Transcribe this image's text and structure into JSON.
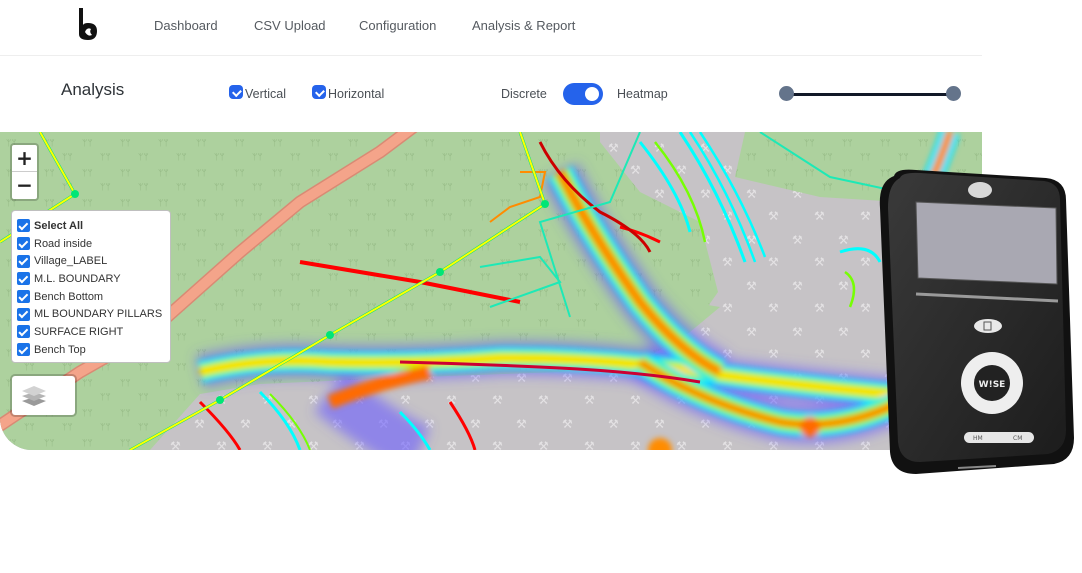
{
  "app": {
    "logo_icon": "brand-b-logo"
  },
  "nav": {
    "items": [
      {
        "label": "Dashboard"
      },
      {
        "label": "CSV Upload"
      },
      {
        "label": "Configuration"
      },
      {
        "label": "Analysis & Report"
      }
    ]
  },
  "controls": {
    "title": "Analysis",
    "checkboxes": [
      {
        "label": "Vertical",
        "checked": true
      },
      {
        "label": "Horizontal",
        "checked": true
      }
    ],
    "view_toggle": {
      "left_label": "Discrete",
      "right_label": "Heatmap",
      "state": "Heatmap"
    },
    "range_slider": {
      "min_fraction": 0,
      "max_fraction": 1
    },
    "accent_color": "#2563eb"
  },
  "map": {
    "zoom_in_label": "+",
    "zoom_out_label": "−",
    "layers_icon": "layers-icon",
    "layers": [
      {
        "label": "Select All",
        "checked": true
      },
      {
        "label": "Road inside",
        "checked": true
      },
      {
        "label": "Village_LABEL",
        "checked": true
      },
      {
        "label": "M.L. BOUNDARY",
        "checked": true
      },
      {
        "label": "Bench Bottom",
        "checked": true
      },
      {
        "label": "ML BOUNDARY PILLARS",
        "checked": true
      },
      {
        "label": "SURFACE RIGHT",
        "checked": true
      },
      {
        "label": "Bench Top",
        "checked": true
      }
    ],
    "colors": {
      "forest": "#add19e",
      "quarry": "#c6c3c6",
      "road": "#f4a48a",
      "boundary_yellow": "#ffff00",
      "boundary_green": "#00e676",
      "bench_red": "#ff0000",
      "bench_cyan": "#00ffff",
      "heat_hot": "#ff6a00"
    }
  },
  "device": {
    "brand_label": "W!SE",
    "left_button_label": "HM",
    "right_button_label": "CM"
  }
}
